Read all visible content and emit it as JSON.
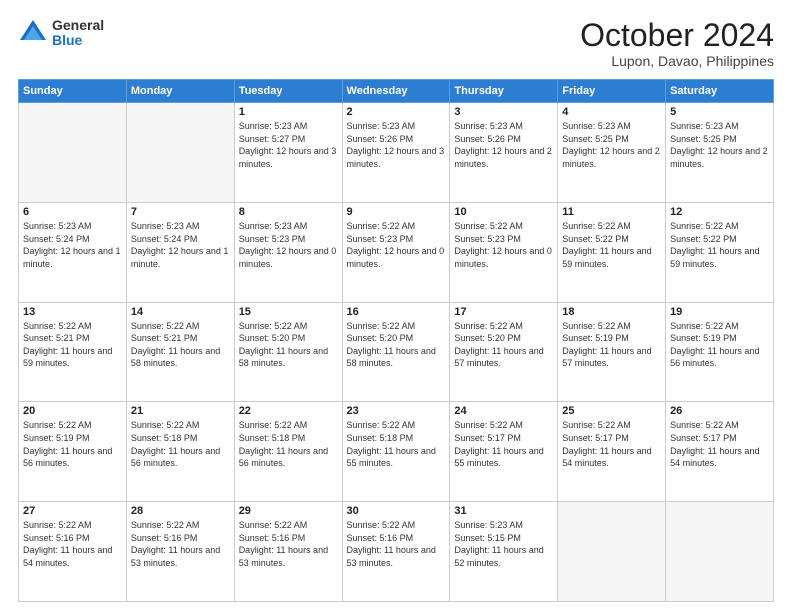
{
  "logo": {
    "general": "General",
    "blue": "Blue"
  },
  "header": {
    "month": "October 2024",
    "location": "Lupon, Davao, Philippines"
  },
  "weekdays": [
    "Sunday",
    "Monday",
    "Tuesday",
    "Wednesday",
    "Thursday",
    "Friday",
    "Saturday"
  ],
  "weeks": [
    [
      {
        "day": "",
        "empty": true
      },
      {
        "day": "",
        "empty": true
      },
      {
        "day": "1",
        "sunrise": "5:23 AM",
        "sunset": "5:27 PM",
        "daylight": "12 hours and 3 minutes."
      },
      {
        "day": "2",
        "sunrise": "5:23 AM",
        "sunset": "5:26 PM",
        "daylight": "12 hours and 3 minutes."
      },
      {
        "day": "3",
        "sunrise": "5:23 AM",
        "sunset": "5:26 PM",
        "daylight": "12 hours and 2 minutes."
      },
      {
        "day": "4",
        "sunrise": "5:23 AM",
        "sunset": "5:25 PM",
        "daylight": "12 hours and 2 minutes."
      },
      {
        "day": "5",
        "sunrise": "5:23 AM",
        "sunset": "5:25 PM",
        "daylight": "12 hours and 2 minutes."
      }
    ],
    [
      {
        "day": "6",
        "sunrise": "5:23 AM",
        "sunset": "5:24 PM",
        "daylight": "12 hours and 1 minute."
      },
      {
        "day": "7",
        "sunrise": "5:23 AM",
        "sunset": "5:24 PM",
        "daylight": "12 hours and 1 minute."
      },
      {
        "day": "8",
        "sunrise": "5:23 AM",
        "sunset": "5:23 PM",
        "daylight": "12 hours and 0 minutes."
      },
      {
        "day": "9",
        "sunrise": "5:22 AM",
        "sunset": "5:23 PM",
        "daylight": "12 hours and 0 minutes."
      },
      {
        "day": "10",
        "sunrise": "5:22 AM",
        "sunset": "5:23 PM",
        "daylight": "12 hours and 0 minutes."
      },
      {
        "day": "11",
        "sunrise": "5:22 AM",
        "sunset": "5:22 PM",
        "daylight": "11 hours and 59 minutes."
      },
      {
        "day": "12",
        "sunrise": "5:22 AM",
        "sunset": "5:22 PM",
        "daylight": "11 hours and 59 minutes."
      }
    ],
    [
      {
        "day": "13",
        "sunrise": "5:22 AM",
        "sunset": "5:21 PM",
        "daylight": "11 hours and 59 minutes."
      },
      {
        "day": "14",
        "sunrise": "5:22 AM",
        "sunset": "5:21 PM",
        "daylight": "11 hours and 58 minutes."
      },
      {
        "day": "15",
        "sunrise": "5:22 AM",
        "sunset": "5:20 PM",
        "daylight": "11 hours and 58 minutes."
      },
      {
        "day": "16",
        "sunrise": "5:22 AM",
        "sunset": "5:20 PM",
        "daylight": "11 hours and 58 minutes."
      },
      {
        "day": "17",
        "sunrise": "5:22 AM",
        "sunset": "5:20 PM",
        "daylight": "11 hours and 57 minutes."
      },
      {
        "day": "18",
        "sunrise": "5:22 AM",
        "sunset": "5:19 PM",
        "daylight": "11 hours and 57 minutes."
      },
      {
        "day": "19",
        "sunrise": "5:22 AM",
        "sunset": "5:19 PM",
        "daylight": "11 hours and 56 minutes."
      }
    ],
    [
      {
        "day": "20",
        "sunrise": "5:22 AM",
        "sunset": "5:19 PM",
        "daylight": "11 hours and 56 minutes."
      },
      {
        "day": "21",
        "sunrise": "5:22 AM",
        "sunset": "5:18 PM",
        "daylight": "11 hours and 56 minutes."
      },
      {
        "day": "22",
        "sunrise": "5:22 AM",
        "sunset": "5:18 PM",
        "daylight": "11 hours and 56 minutes."
      },
      {
        "day": "23",
        "sunrise": "5:22 AM",
        "sunset": "5:18 PM",
        "daylight": "11 hours and 55 minutes."
      },
      {
        "day": "24",
        "sunrise": "5:22 AM",
        "sunset": "5:17 PM",
        "daylight": "11 hours and 55 minutes."
      },
      {
        "day": "25",
        "sunrise": "5:22 AM",
        "sunset": "5:17 PM",
        "daylight": "11 hours and 54 minutes."
      },
      {
        "day": "26",
        "sunrise": "5:22 AM",
        "sunset": "5:17 PM",
        "daylight": "11 hours and 54 minutes."
      }
    ],
    [
      {
        "day": "27",
        "sunrise": "5:22 AM",
        "sunset": "5:16 PM",
        "daylight": "11 hours and 54 minutes."
      },
      {
        "day": "28",
        "sunrise": "5:22 AM",
        "sunset": "5:16 PM",
        "daylight": "11 hours and 53 minutes."
      },
      {
        "day": "29",
        "sunrise": "5:22 AM",
        "sunset": "5:16 PM",
        "daylight": "11 hours and 53 minutes."
      },
      {
        "day": "30",
        "sunrise": "5:22 AM",
        "sunset": "5:16 PM",
        "daylight": "11 hours and 53 minutes."
      },
      {
        "day": "31",
        "sunrise": "5:23 AM",
        "sunset": "5:15 PM",
        "daylight": "11 hours and 52 minutes."
      },
      {
        "day": "",
        "empty": true
      },
      {
        "day": "",
        "empty": true
      }
    ]
  ]
}
